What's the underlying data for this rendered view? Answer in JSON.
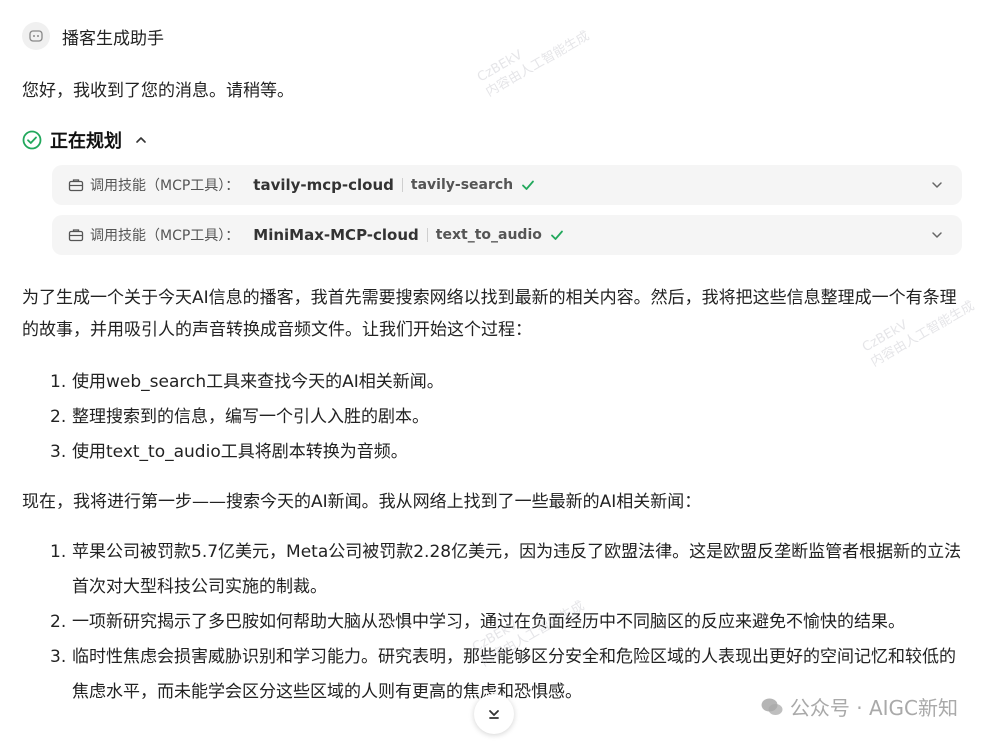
{
  "header": {
    "title": "播客生成助手",
    "avatar_icon": "bot-face-icon"
  },
  "reply": {
    "greeting": "您好，我收到了您的消息。请稍等。"
  },
  "planning": {
    "title": "正在规划",
    "status_icon": "check-circle-icon"
  },
  "tool_calls": [
    {
      "label": "调用技能（MCP工具）：",
      "server": "MiniMax-MCP-cloud",
      "tool": "text_to_audio",
      "status": "success"
    }
  ],
  "tool_calls_first": {
    "label": "调用技能（MCP工具）：",
    "server": "tavily-mcp-cloud",
    "tool": "tavily-search",
    "status": "success"
  },
  "intro": "为了生成一个关于今天AI信息的播客，我首先需要搜索网络以找到最新的相关内容。然后，我将把这些信息整理成一个有条理的故事，并用吸引人的声音转换成音频文件。让我们开始这个过程：",
  "steps": [
    {
      "num": "1.",
      "text": "使用web_search工具来查找今天的AI相关新闻。"
    },
    {
      "num": "2.",
      "text": "整理搜索到的信息，编写一个引人入胜的剧本。"
    },
    {
      "num": "3.",
      "text": "使用text_to_audio工具将剧本转换为音频。"
    }
  ],
  "progress": "现在，我将进行第一步——搜索今天的AI新闻。我从网络上找到了一些最新的AI相关新闻：",
  "news": [
    {
      "num": "1.",
      "text": "苹果公司被罚款5.7亿美元，Meta公司被罚款2.28亿美元，因为违反了欧盟法律。这是欧盟反垄断监管者根据新的立法首次对大型科技公司实施的制裁。"
    },
    {
      "num": "2.",
      "text": "一项新研究揭示了多巴胺如何帮助大脑从恐惧中学习，通过在负面经历中不同脑区的反应来避免不愉快的结果。"
    },
    {
      "num": "3.",
      "text": "临时性焦虑会损害威胁识别和学习能力。研究表明，那些能够区分安全和危险区域的人表现出更好的空间记忆和较低的焦虑水平，而未能学会区分这些区域的人则有更高的焦虑和恐惧感。"
    }
  ],
  "watermark": {
    "line1": "CzBEkV",
    "line2": "内容由人工智能生成"
  },
  "brand": {
    "text": "公众号 · AIGC新知"
  },
  "colors": {
    "check_green": "#22a85c",
    "card_bg": "#f5f5f5"
  }
}
